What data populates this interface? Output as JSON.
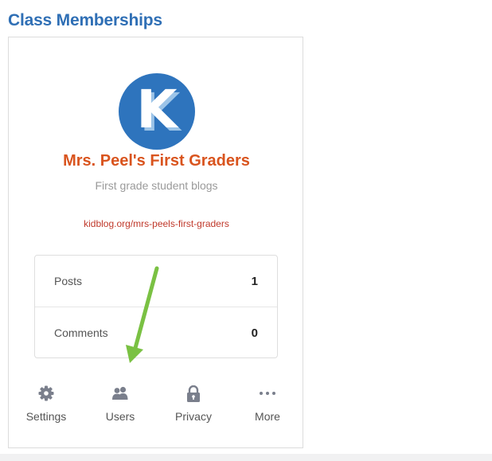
{
  "page": {
    "title": "Class Memberships"
  },
  "class_card": {
    "name": "Mrs. Peel's First Graders",
    "description": "First grade student blogs",
    "url": "kidblog.org/mrs-peels-first-graders",
    "logo_letter": "K",
    "stats": [
      {
        "label": "Posts",
        "value": "1"
      },
      {
        "label": "Comments",
        "value": "0"
      }
    ],
    "actions": [
      {
        "label": "Settings",
        "icon": "gear-icon"
      },
      {
        "label": "Users",
        "icon": "users-icon"
      },
      {
        "label": "Privacy",
        "icon": "lock-icon"
      },
      {
        "label": "More",
        "icon": "ellipsis-icon"
      }
    ]
  },
  "colors": {
    "title": "#2f6fb5",
    "class_name": "#d9541e",
    "url": "#c0392b",
    "logo_bg": "#2e74bd",
    "arrow": "#7ac143",
    "icon": "#7a7f8c"
  }
}
